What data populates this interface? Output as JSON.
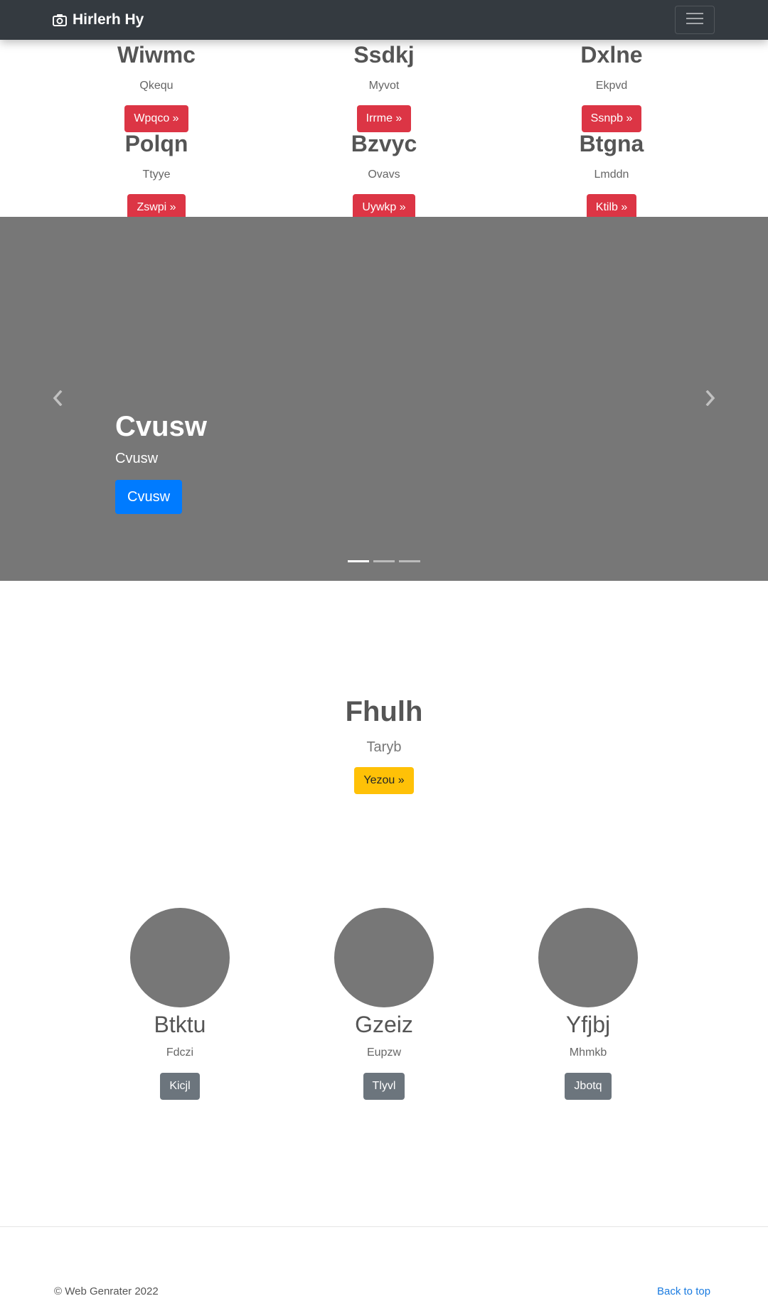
{
  "navbar": {
    "brand": "Hirlerh Hy",
    "brand_icon": "camera-icon",
    "toggler_icon": "hamburger-icon"
  },
  "features": [
    {
      "title": "Wiwmc",
      "text": "Qkequ",
      "button": "Wpqco »"
    },
    {
      "title": "Ssdkj",
      "text": "Myvot",
      "button": "Irrme »"
    },
    {
      "title": "Dxlne",
      "text": "Ekpvd",
      "button": "Ssnpb »"
    },
    {
      "title": "Polqn",
      "text": "Ttyye",
      "button": "Zswpi »"
    },
    {
      "title": "Bzvyc",
      "text": "Ovavs",
      "button": "Uywkp »"
    },
    {
      "title": "Btgna",
      "text": "Lmddn",
      "button": "Ktilb »"
    }
  ],
  "carousel": {
    "title": "Cvusw",
    "text": "Cvusw",
    "button": "Cvusw",
    "prev_icon": "chevron-left-icon",
    "next_icon": "chevron-right-icon",
    "slides": 3,
    "active_slide": 1
  },
  "hero": {
    "title": "Fhulh",
    "text": "Taryb",
    "button": "Yezou »"
  },
  "team": [
    {
      "name": "Btktu",
      "text": "Fdczi",
      "button": "Kicjl"
    },
    {
      "name": "Gzeiz",
      "text": "Eupzw",
      "button": "Tlyvl"
    },
    {
      "name": "Yfjbj",
      "text": "Mhmkb",
      "button": "Jbotq"
    }
  ],
  "footer": {
    "copyright": "© Web Genrater 2022",
    "back_to_top": "Back to top"
  },
  "colors": {
    "navbar": "#343a40",
    "danger": "#dc3545",
    "primary": "#007bff",
    "warning": "#ffc107",
    "secondary": "#6c757d",
    "placeholder": "#777777"
  }
}
